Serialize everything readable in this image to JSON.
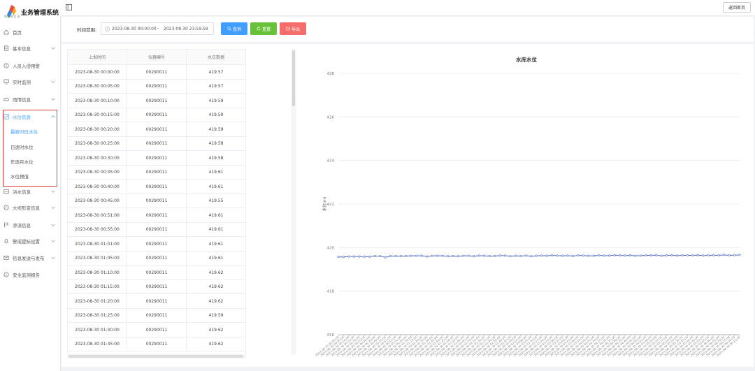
{
  "app": {
    "brand": "业务管理系统",
    "logo_sub": "智 水利信 息",
    "back_home": "返回首页"
  },
  "sidebar": {
    "items": [
      {
        "label": "首页",
        "icon": "home-icon",
        "chevron": false
      },
      {
        "label": "基本信息",
        "icon": "document-icon",
        "chevron": true
      },
      {
        "label": "人员入侵预警",
        "icon": "alert-circle-icon",
        "chevron": false
      },
      {
        "label": "实时监测",
        "icon": "monitor-icon",
        "chevron": true
      },
      {
        "label": "雨情信息",
        "icon": "cloud-icon",
        "chevron": true
      },
      {
        "label": "水位信息",
        "icon": "chart-icon",
        "chevron": true,
        "active": true
      },
      {
        "label": "洪水信息",
        "icon": "flood-icon",
        "chevron": true
      },
      {
        "label": "大坝形变信息",
        "icon": "dam-icon",
        "chevron": true
      },
      {
        "label": "渗流信息",
        "icon": "flag-icon",
        "chevron": true
      },
      {
        "label": "警戒提标设置",
        "icon": "bell-icon",
        "chevron": true
      },
      {
        "label": "信息发送与发布",
        "icon": "mail-icon",
        "chevron": true
      },
      {
        "label": "安全监测报告",
        "icon": "info-icon",
        "chevron": false
      }
    ],
    "water_submenu": [
      {
        "label": "最新时段水位",
        "active": true
      },
      {
        "label": "日逐时水位",
        "active": false
      },
      {
        "label": "年逐月水位",
        "active": false
      },
      {
        "label": "水位预值",
        "active": false
      }
    ]
  },
  "filter": {
    "label": "时间范围:",
    "start": "2023-08-30 00:00:00",
    "sep": "-",
    "end": "2023-08-30 23:59:59",
    "query": "查询",
    "reset": "重置",
    "export": "导出"
  },
  "table": {
    "headers": [
      "上报时间",
      "仪器编号",
      "水位数据"
    ],
    "rows": [
      [
        "2023-08-30 00:00:00",
        "00290011",
        "419.57"
      ],
      [
        "2023-08-30 00:05:00",
        "00290011",
        "419.57"
      ],
      [
        "2023-08-30 00:10:00",
        "00290011",
        "419.59"
      ],
      [
        "2023-08-30 00:15:00",
        "00290011",
        "419.59"
      ],
      [
        "2023-08-30 00:20:00",
        "00290011",
        "419.59"
      ],
      [
        "2023-08-30 00:25:00",
        "00290011",
        "419.58"
      ],
      [
        "2023-08-30 00:30:00",
        "00290011",
        "419.58"
      ],
      [
        "2023-08-30 00:35:00",
        "00290011",
        "419.61"
      ],
      [
        "2023-08-30 00:40:00",
        "00290011",
        "419.61"
      ],
      [
        "2023-08-30 00:45:00",
        "00290011",
        "419.55"
      ],
      [
        "2023-08-30 00:51:00",
        "00290011",
        "419.61"
      ],
      [
        "2023-08-30 00:55:00",
        "00290011",
        "419.61"
      ],
      [
        "2023-08-30 01:01:00",
        "00290011",
        "419.61"
      ],
      [
        "2023-08-30 01:05:00",
        "00290011",
        "419.61"
      ],
      [
        "2023-08-30 01:10:00",
        "00290011",
        "419.62"
      ],
      [
        "2023-08-30 01:15:00",
        "00290011",
        "419.62"
      ],
      [
        "2023-08-30 01:20:00",
        "00290011",
        "419.62"
      ],
      [
        "2023-08-30 01:25:00",
        "00290011",
        "419.59"
      ],
      [
        "2023-08-30 01:30:00",
        "00290011",
        "419.62"
      ],
      [
        "2023-08-30 01:35:00",
        "00290011",
        "419.62"
      ]
    ]
  },
  "chart_data": {
    "type": "line",
    "title": "水库水位",
    "ylabel": "水位(m)",
    "xlabel": "",
    "ylim": [
      416,
      428
    ],
    "yticks": [
      416,
      418,
      420,
      422,
      424,
      426,
      428
    ],
    "grid": true,
    "color": "#5470c6",
    "x": [
      "2023-08-30 00:00:00",
      "2023-08-30 00:05:00",
      "2023-08-30 00:10:00",
      "2023-08-30 00:15:00",
      "2023-08-30 00:20:00",
      "2023-08-30 00:25:00",
      "2023-08-30 00:30:00",
      "2023-08-30 00:35:00",
      "2023-08-30 00:40:00",
      "2023-08-30 00:45:00",
      "2023-08-30 00:51:00",
      "2023-08-30 00:55:00",
      "2023-08-30 01:01:00",
      "2023-08-30 01:05:00",
      "2023-08-30 01:10:00",
      "2023-08-30 01:15:00",
      "2023-08-30 01:20:00",
      "2023-08-30 01:25:00",
      "2023-08-30 01:30:00",
      "2023-08-30 01:35:00",
      "2023-08-30 01:40:00",
      "2023-08-30 01:45:00",
      "2023-08-30 01:50:00",
      "2023-08-30 01:55:00",
      "2023-08-30 02:00:00",
      "2023-08-30 02:05:00",
      "2023-08-30 02:10:00",
      "2023-08-30 02:15:00",
      "2023-08-30 02:20:00",
      "2023-08-30 02:25:00",
      "2023-08-30 02:30:00",
      "2023-08-30 02:35:00",
      "2023-08-30 02:40:00",
      "2023-08-30 02:45:00",
      "2023-08-30 02:50:00",
      "2023-08-30 02:55:00",
      "2023-08-30 03:00:00",
      "2023-08-30 03:05:00",
      "2023-08-30 03:10:00",
      "2023-08-30 03:15:00",
      "2023-08-30 03:20:00",
      "2023-08-30 03:25:00",
      "2023-08-30 03:30:00",
      "2023-08-30 03:35:00",
      "2023-08-30 03:40:00",
      "2023-08-30 03:45:00",
      "2023-08-30 03:50:00",
      "2023-08-30 03:55:00",
      "2023-08-30 04:00:00",
      "2023-08-30 04:05:00",
      "2023-08-30 04:10:00",
      "2023-08-30 04:15:00",
      "2023-08-30 04:20:00",
      "2023-08-30 04:25:00",
      "2023-08-30 04:30:00",
      "2023-08-30 04:35:00",
      "2023-08-30 04:40:00",
      "2023-08-30 04:45:00",
      "2023-08-30 04:50:00",
      "2023-08-30 04:55:00",
      "2023-08-30 05:00:00",
      "2023-08-30 05:05:00",
      "2023-08-30 05:10:00",
      "2023-08-30 05:15:00",
      "2023-08-30 05:20:00",
      "2023-08-30 05:25:00",
      "2023-08-30 05:30:00",
      "2023-08-30 05:35:00",
      "2023-08-30 05:40:00",
      "2023-08-30 05:45:00",
      "2023-08-30 05:50:00",
      "2023-08-30 05:55:00",
      "2023-08-30 06:00:00",
      "2023-08-30 06:05:00",
      "2023-08-30 06:10:00",
      "2023-08-30 06:15:00",
      "2023-08-30 06:20:00",
      "2023-08-30 06:25:00"
    ],
    "values": [
      419.57,
      419.57,
      419.59,
      419.59,
      419.59,
      419.58,
      419.58,
      419.61,
      419.61,
      419.55,
      419.61,
      419.61,
      419.61,
      419.61,
      419.62,
      419.62,
      419.62,
      419.59,
      419.62,
      419.62,
      419.62,
      419.6,
      419.61,
      419.6,
      419.62,
      419.62,
      419.6,
      419.63,
      419.62,
      419.61,
      419.61,
      419.63,
      419.63,
      419.6,
      419.62,
      419.61,
      419.63,
      419.6,
      419.62,
      419.63,
      419.62,
      419.64,
      419.63,
      419.62,
      419.63,
      419.61,
      419.64,
      419.63,
      419.62,
      419.62,
      419.64,
      419.63,
      419.63,
      419.65,
      419.64,
      419.63,
      419.64,
      419.62,
      419.63,
      419.64,
      419.64,
      419.65,
      419.62,
      419.64,
      419.65,
      419.63,
      419.64,
      419.64,
      419.64,
      419.65,
      419.63,
      419.64,
      419.65,
      419.64,
      419.66,
      419.64,
      419.65,
      419.66
    ]
  }
}
